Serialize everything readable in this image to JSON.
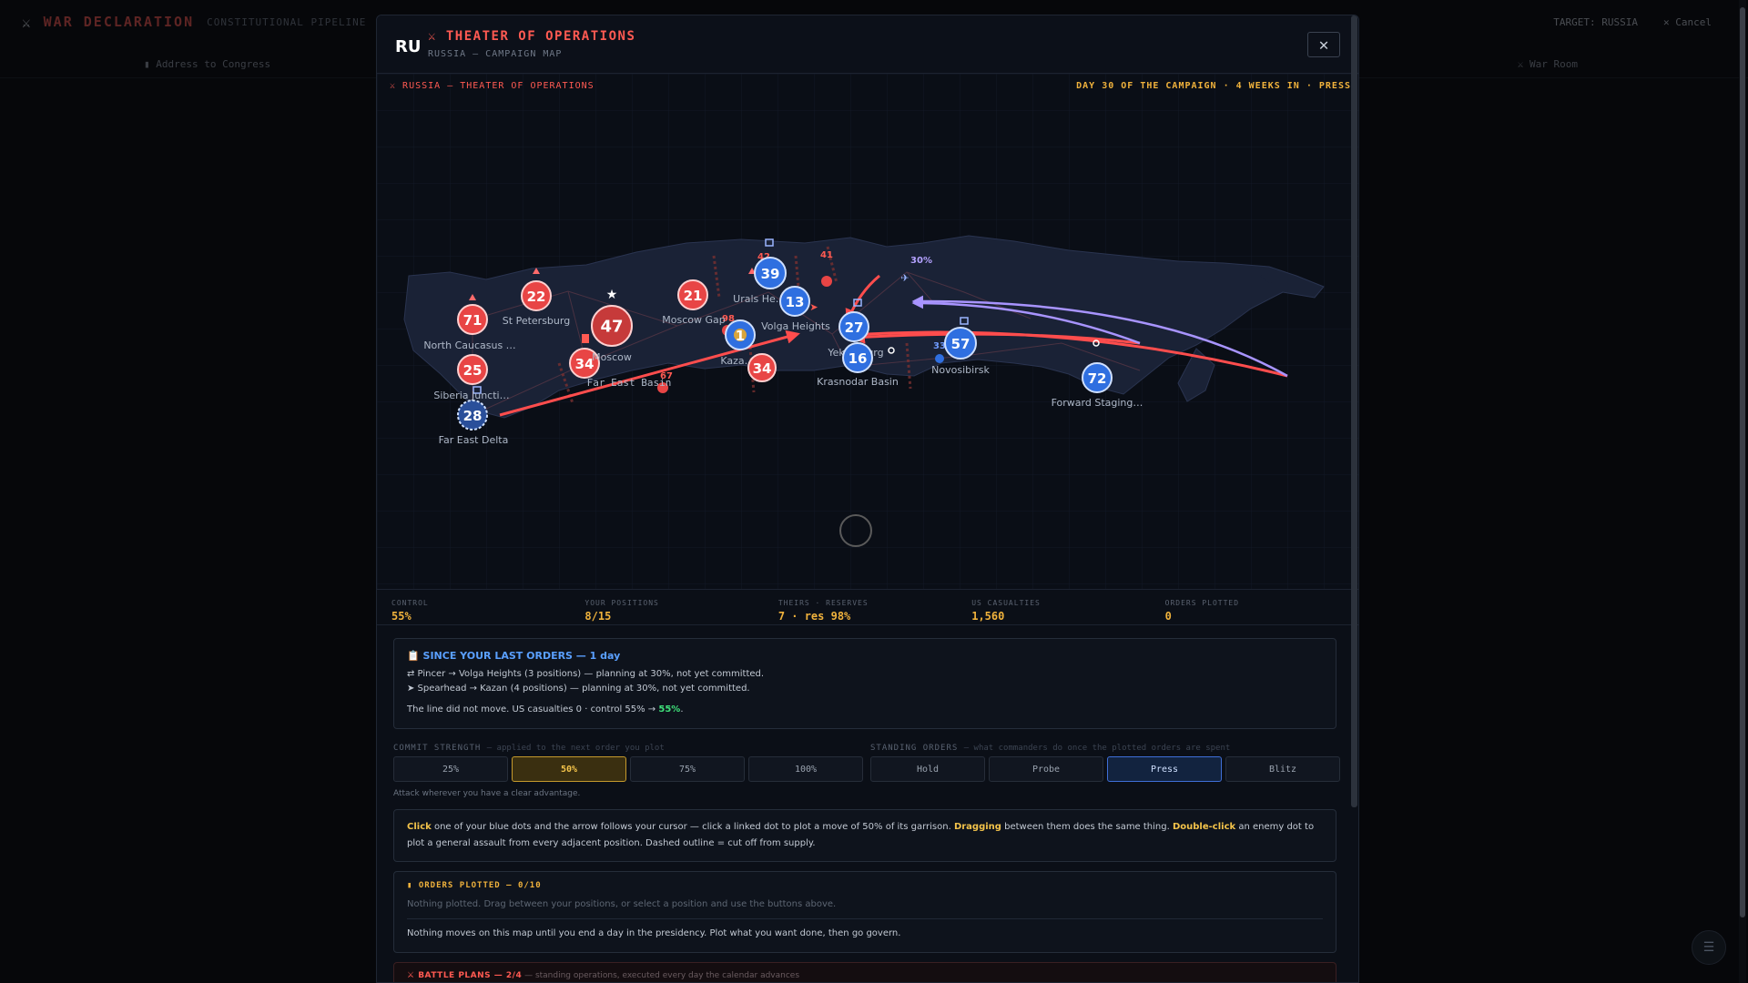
{
  "background": {
    "title": "WAR DECLARATION",
    "subtitle": "CONSTITUTIONAL PIPELINE",
    "target": "TARGET: RUSSIA",
    "cancel": "Cancel",
    "address": "Address to Congress",
    "war_room": "War Room"
  },
  "modal": {
    "flag": "RU",
    "title": "THEATER OF OPERATIONS",
    "subtitle": "RUSSIA — CAMPAIGN MAP",
    "map_title": "RUSSIA — THEATER OF OPERATIONS",
    "map_status": "DAY 30 OF THE CAMPAIGN · 4 WEEKS IN · PRESS"
  },
  "colors": {
    "enemy": "#e84545",
    "friendly": "#2f6fe0",
    "accent": "#f0b23c",
    "purple": "#9b87ff"
  },
  "map": {
    "nodes": [
      {
        "id": "n71",
        "value": "71",
        "side": "enemy",
        "label": "North Caucasus …"
      },
      {
        "id": "n22",
        "value": "22",
        "side": "enemy",
        "label": "St Petersburg"
      },
      {
        "id": "n47",
        "value": "47",
        "side": "enemy",
        "label": ""
      },
      {
        "id": "n34a",
        "value": "34",
        "side": "enemy",
        "label": "Moscow"
      },
      {
        "id": "n25",
        "value": "25",
        "side": "enemy",
        "label": "Siberia Juncti…"
      },
      {
        "id": "n28",
        "value": "28",
        "side": "friendly",
        "label": "Far East Delta"
      },
      {
        "id": "n21",
        "value": "21",
        "side": "enemy",
        "label": "Moscow Gap"
      },
      {
        "id": "n39",
        "value": "39",
        "side": "friendly",
        "label": "Urals He…"
      },
      {
        "id": "n13",
        "value": "13",
        "side": "friendly",
        "label": "Volga Heights"
      },
      {
        "id": "nk",
        "value": "1",
        "side": "friendly",
        "label": "Kaza…"
      },
      {
        "id": "n34b",
        "value": "34",
        "side": "enemy",
        "label": ""
      },
      {
        "id": "n27",
        "value": "27",
        "side": "friendly",
        "label": "Yeka…burg"
      },
      {
        "id": "n16",
        "value": "16",
        "side": "friendly",
        "label": "Krasnodar Basin"
      },
      {
        "id": "n57",
        "value": "57",
        "side": "friendly",
        "label": "Novosibirsk"
      },
      {
        "id": "n72",
        "value": "72",
        "side": "friendly",
        "label": "Forward Staging…"
      }
    ],
    "far_east_basin_label": "Far East Basin",
    "small_values": [
      "98",
      "67",
      "42",
      "41",
      "33"
    ],
    "pincer_pct": "30%"
  },
  "stats": [
    {
      "key": "CONTROL",
      "value": "55%"
    },
    {
      "key": "YOUR POSITIONS",
      "value": "8/15"
    },
    {
      "key": "THEIRS · RESERVES",
      "value": "7 · res 98%"
    },
    {
      "key": "US CASUALTIES",
      "value": "1,560"
    },
    {
      "key": "ORDERS PLOTTED",
      "value": "0"
    }
  ],
  "since": {
    "title": "SINCE YOUR LAST ORDERS — 1 day",
    "line1": "⇄ Pincer → Volga Heights (3 positions) — planning at 30%, not yet committed.",
    "line2": "➤ Spearhead → Kazan (4 positions) — planning at 30%, not yet committed.",
    "line3": "The line did not move. US casualties 0 · control 55% → ",
    "line3_end": "55%",
    "line3_dot": "."
  },
  "commit": {
    "label": "COMMIT STRENGTH",
    "note": "— applied to the next order you plot",
    "options": [
      "25%",
      "50%",
      "75%",
      "100%"
    ],
    "hint": "Attack wherever you have a clear advantage."
  },
  "standing": {
    "label": "STANDING ORDERS",
    "note": "— what commanders do once the plotted orders are spent",
    "options": [
      "Hold",
      "Probe",
      "Press",
      "Blitz"
    ]
  },
  "instructions": {
    "click": "Click",
    "t1": " one of your blue dots and the arrow follows your cursor — click a linked dot to plot a move of 50% of its garrison. ",
    "dragging": "Dragging",
    "t2": " between them does the same thing. ",
    "dbl": "Double-click",
    "t3": " an enemy dot to plot a general assault from every adjacent position. Dashed outline = cut off from supply."
  },
  "orders": {
    "title": "ORDERS PLOTTED — 0/10",
    "empty": "Nothing plotted. Drag between your positions, or select a position and use the buttons above.",
    "footer": "Nothing moves on this map until you end a day in the presidency. Plot what you want done, then go govern."
  },
  "plans": {
    "title": "⚔ BATTLE PLANS — 2/4",
    "note": " — standing operations, executed every day the calendar advances"
  }
}
